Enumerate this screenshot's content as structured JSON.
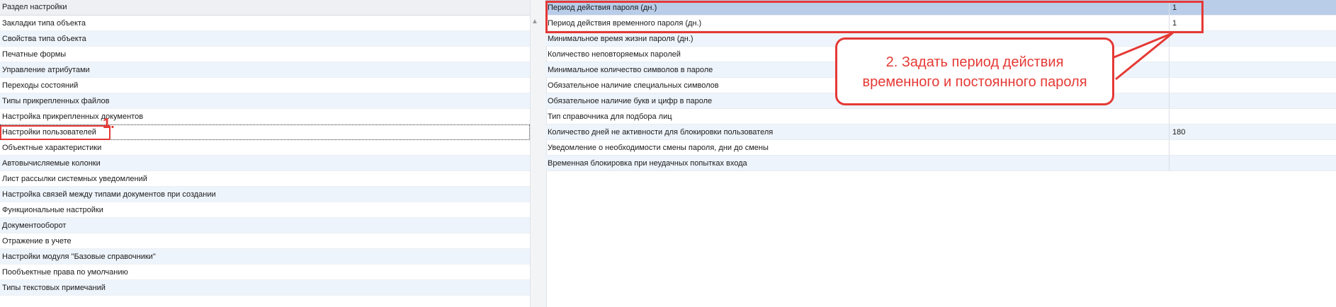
{
  "left_panel": {
    "header": "Раздел настройки",
    "items": [
      "Закладки типа объекта",
      "Свойства типа объекта",
      "Печатные формы",
      "Управление атрибутами",
      "Переходы состояний",
      "Типы прикрепленных файлов",
      "Настройка прикрепленных документов",
      "Настройки пользователей",
      "Объектные характеристики",
      "Автовычисляемые колонки",
      "Лист рассылки системных уведомлений",
      "Настройка связей между типами документов при создании",
      "Функциональные настройки",
      "Документооборот",
      "Отражение в учете",
      "Настройки модуля \"Базовые справочники\"",
      "Пообъектные права по умолчанию",
      "Типы текстовых примечаний"
    ]
  },
  "right_panel": {
    "rows": [
      {
        "name": "Период действия пароля (дн.)",
        "value": "1"
      },
      {
        "name": "Период действия временного пароля (дн.)",
        "value": "1"
      },
      {
        "name": "Минимальное время жизни пароля (дн.)",
        "value": ""
      },
      {
        "name": "Количество неповторяемых паролей",
        "value": ""
      },
      {
        "name": "Минимальное количество символов в пароле",
        "value": ""
      },
      {
        "name": "Обязательное наличие специальных символов",
        "value": ""
      },
      {
        "name": "Обязательное наличие букв и цифр в пароле",
        "value": ""
      },
      {
        "name": "Тип справочника для подбора лиц",
        "value": ""
      },
      {
        "name": "Количество дней не активности для блокировки пользователя",
        "value": "180"
      },
      {
        "name": "Уведомление о необходимости смены пароля, дни до смены",
        "value": ""
      },
      {
        "name": "Временная блокировка при неудачных попытках входа",
        "value": ""
      }
    ]
  },
  "annotations": {
    "label_1": "1.",
    "callout_line_1": "2. Задать период действия",
    "callout_line_2": "временного и постоянного пароля"
  },
  "colors": {
    "annotation_red": "#e53935",
    "row_alt": "#eef4fb",
    "row_selected": "#b9cde9"
  }
}
